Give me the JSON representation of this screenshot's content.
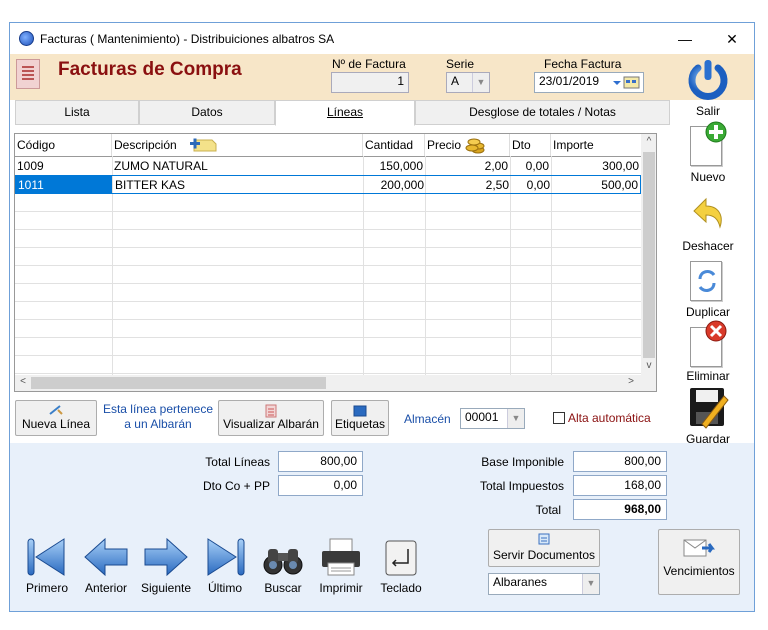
{
  "window": {
    "title": "Facturas ( Mantenimiento) - Distribuiciones albatros SA",
    "minimize": "—",
    "close": "✕"
  },
  "header": {
    "title": "Facturas de Compra",
    "invoice_no_label": "Nº de Factura",
    "invoice_no_value": "1",
    "series_label": "Serie",
    "series_value": "A",
    "date_label": "Fecha Factura",
    "date_value": "23/01/2019"
  },
  "tabs": [
    {
      "label": "Lista",
      "active": false
    },
    {
      "label": "Datos",
      "active": false
    },
    {
      "label": "Líneas",
      "active": true
    },
    {
      "label": "Desglose de totales / Notas",
      "active": false
    }
  ],
  "grid": {
    "columns": [
      "Código",
      "Descripción",
      "Cantidad",
      "Precio",
      "Dto",
      "Importe"
    ],
    "rows": [
      {
        "code": "1009",
        "description": "ZUMO NATURAL",
        "quantity": "150,000",
        "price": "2,00",
        "dto": "0,00",
        "amount": "300,00",
        "selected": false
      },
      {
        "code": "1011",
        "description": "BITTER KAS",
        "quantity": "200,000",
        "price": "2,50",
        "dto": "0,00",
        "amount": "500,00",
        "selected": true
      }
    ]
  },
  "line_actions": {
    "new_line": "Nueva Línea",
    "albaran_note_1": "Esta línea pertenece",
    "albaran_note_2": "a un Albarán",
    "view_albaran": "Visualizar Albarán",
    "labels": "Etiquetas",
    "warehouse_label": "Almacén",
    "warehouse_value": "00001",
    "auto_register": "Alta automática"
  },
  "right_toolbar": {
    "exit": "Salir",
    "new": "Nuevo",
    "undo": "Deshacer",
    "duplicate": "Duplicar",
    "delete": "Eliminar",
    "save": "Guardar"
  },
  "totals": {
    "total_lines_label": "Total Líneas",
    "total_lines_value": "800,00",
    "dto_label": "Dto Co + PP",
    "dto_value": "0,00",
    "tax_base_label": "Base Imponible",
    "tax_base_value": "800,00",
    "total_tax_label": "Total Impuestos",
    "total_tax_value": "168,00",
    "total_label": "Total",
    "total_value": "968,00"
  },
  "navigation": {
    "first": "Primero",
    "previous": "Anterior",
    "next": "Siguiente",
    "last": "Último",
    "search": "Buscar",
    "print": "Imprimir",
    "keyboard": "Teclado"
  },
  "documents": {
    "serve_documents": "Servir Documentos",
    "doc_type_value": "Albaranes",
    "due_dates": "Vencimientos"
  },
  "colors": {
    "header_bg": "#f7e6c8",
    "title_color": "#8a1010",
    "bottom_bg": "#e8f0fa",
    "selection": "#0078d7"
  }
}
